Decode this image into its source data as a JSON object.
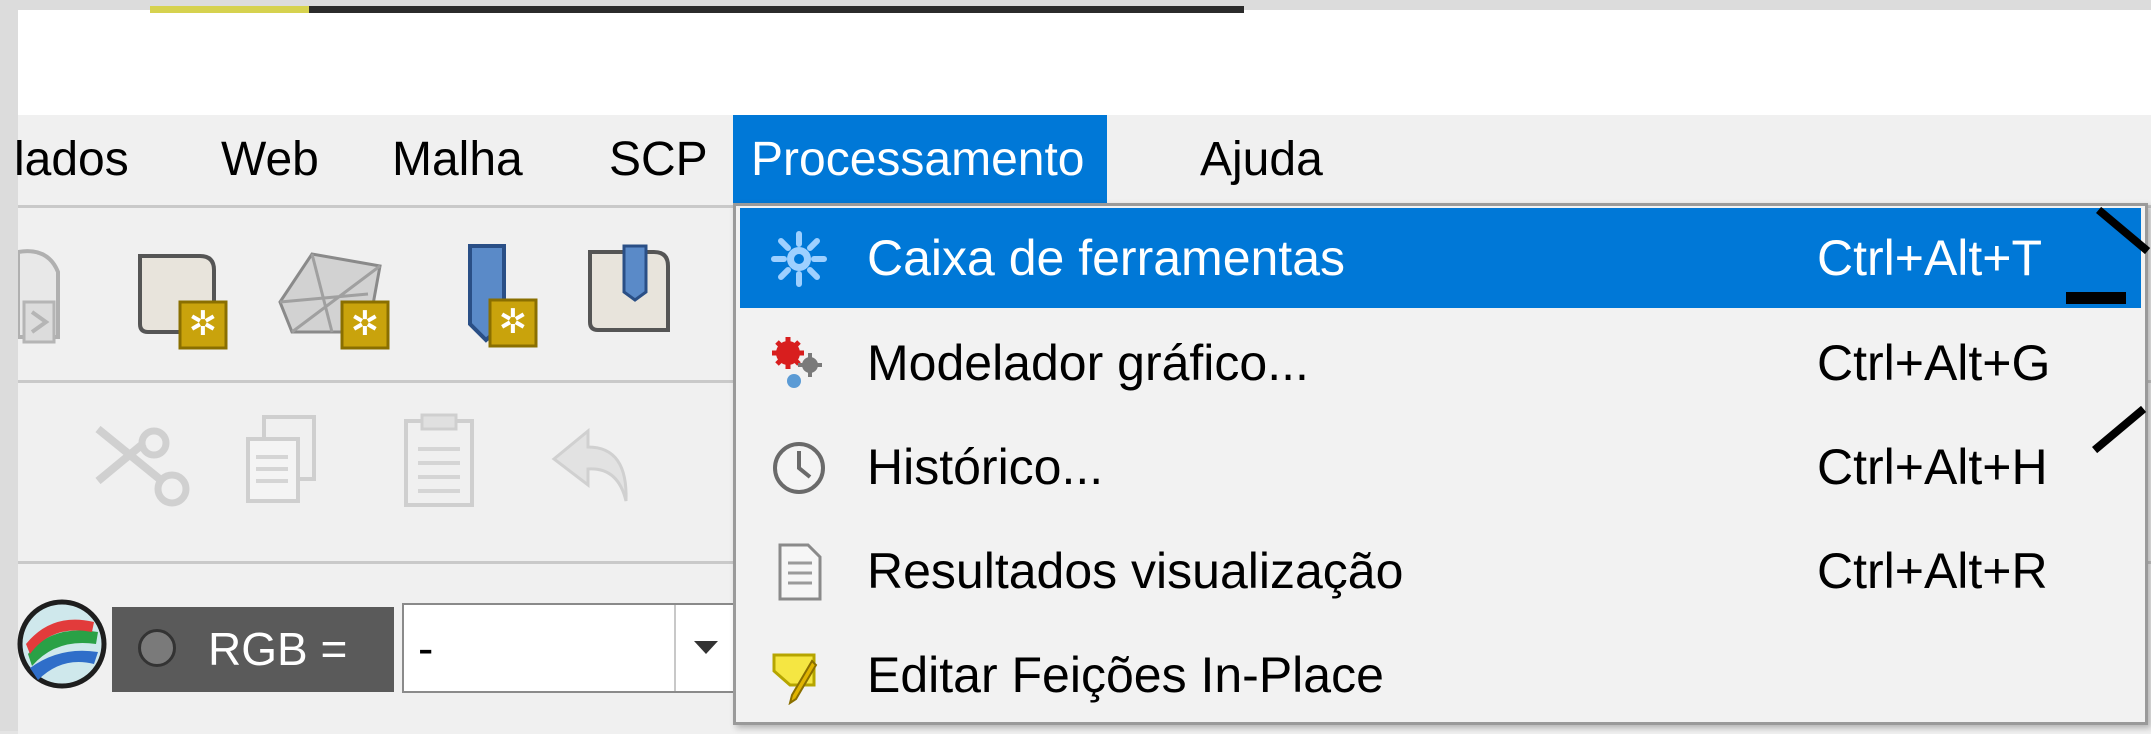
{
  "menubar": {
    "items": [
      {
        "label": "lados"
      },
      {
        "label": "Web"
      },
      {
        "label": "Malha"
      },
      {
        "label": "SCP"
      },
      {
        "label": "Processamento"
      },
      {
        "label": "Ajuda"
      }
    ],
    "active": "Processamento"
  },
  "progress": {
    "fraction": 0.145
  },
  "raster_toolbar": {
    "toggle_label": "RGB =",
    "combo_value": "-"
  },
  "processing_menu": {
    "items": [
      {
        "label": "Caixa de ferramentas",
        "shortcut": "Ctrl+Alt+T",
        "icon": "gear-icon",
        "highlighted": true
      },
      {
        "label": "Modelador gráfico...",
        "shortcut": "Ctrl+Alt+G",
        "icon": "model-designer-icon"
      },
      {
        "label": "Histórico...",
        "shortcut": "Ctrl+Alt+H",
        "icon": "clock-icon"
      },
      {
        "label": "Resultados visualização",
        "shortcut": "Ctrl+Alt+R",
        "icon": "document-icon"
      },
      {
        "label": "Editar Feições In-Place",
        "shortcut": "",
        "icon": "edit-in-place-icon"
      }
    ]
  },
  "colors": {
    "highlight": "#0078d7",
    "menubar_bg": "#f0f0f0",
    "menu_bg": "#f2f2f2"
  }
}
